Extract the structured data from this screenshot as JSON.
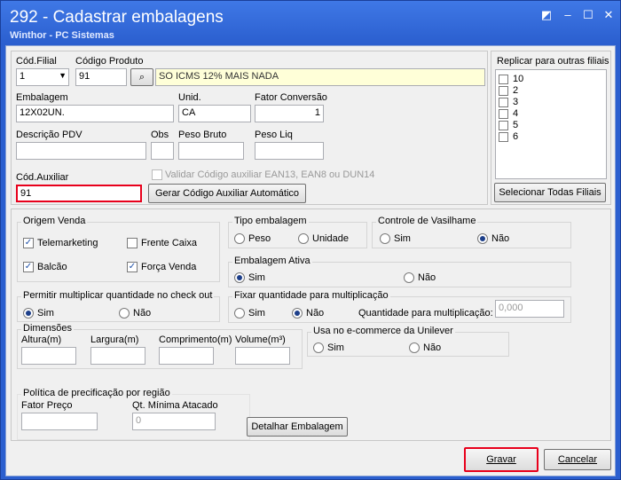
{
  "window": {
    "title": "292 - Cadastrar embalagens",
    "subtitle": "Winthor - PC Sistemas"
  },
  "form": {
    "cod_filial_label": "Cód.Filial",
    "cod_filial_value": "1",
    "cod_produto_label": "Código Produto",
    "cod_produto_value": "91",
    "produto_desc": "SO ICMS 12% MAIS NADA",
    "embalagem_label": "Embalagem",
    "embalagem_value": "12X02UN.",
    "unid_label": "Unid.",
    "unid_value": "CA",
    "fator_label": "Fator Conversão",
    "fator_value": "1",
    "desc_pdv_label": "Descrição PDV",
    "desc_pdv_value": "",
    "obs_label": "Obs",
    "peso_bruto_label": "Peso Bruto",
    "peso_liq_label": "Peso Liq",
    "cod_aux_label": "Cód.Auxiliar",
    "cod_aux_value": "91",
    "validar_label": "Validar Código auxiliar EAN13, EAN8 ou DUN14",
    "gerar_button": "Gerar Código Auxiliar Automático"
  },
  "replicar": {
    "title": "Replicar para outras filiais",
    "items": [
      "10",
      "2",
      "3",
      "4",
      "5",
      "6"
    ],
    "select_all_button": "Selecionar Todas Filiais"
  },
  "origem": {
    "title": "Origem Venda",
    "telemarketing": "Telemarketing",
    "frente_caixa": "Frente Caixa",
    "balcao": "Balcão",
    "forca_venda": "Força Venda"
  },
  "tipo_embalagem": {
    "title": "Tipo embalagem",
    "peso": "Peso",
    "unidade": "Unidade"
  },
  "vasilhame": {
    "title": "Controle de Vasilhame",
    "sim": "Sim",
    "nao": "Não"
  },
  "ativa": {
    "title": "Embalagem Ativa",
    "sim": "Sim",
    "nao": "Não"
  },
  "multiplicar": {
    "title": "Permitir multiplicar quantidade no check out",
    "sim": "Sim",
    "nao": "Não"
  },
  "fixar": {
    "title": "Fixar quantidade para multiplicação",
    "sim": "Sim",
    "nao": "Não",
    "qtd_label": "Quantidade para multiplicação:",
    "qtd_value": "0,000"
  },
  "dimensoes": {
    "title": "Dimensões",
    "altura": "Altura(m)",
    "largura": "Largura(m)",
    "comprimento": "Comprimento(m)",
    "volume": "Volume(m³)"
  },
  "unilever": {
    "title": "Usa no e-commerce da Unilever",
    "sim": "Sim",
    "nao": "Não"
  },
  "preco": {
    "title": "Política de precificação por região",
    "fator_label": "Fator Preço",
    "qt_label": "Qt. Mínima Atacado",
    "qt_value": "0",
    "detalhar_button": "Detalhar Embalagem"
  },
  "footer": {
    "gravar": "Gravar",
    "cancelar": "Cancelar"
  }
}
